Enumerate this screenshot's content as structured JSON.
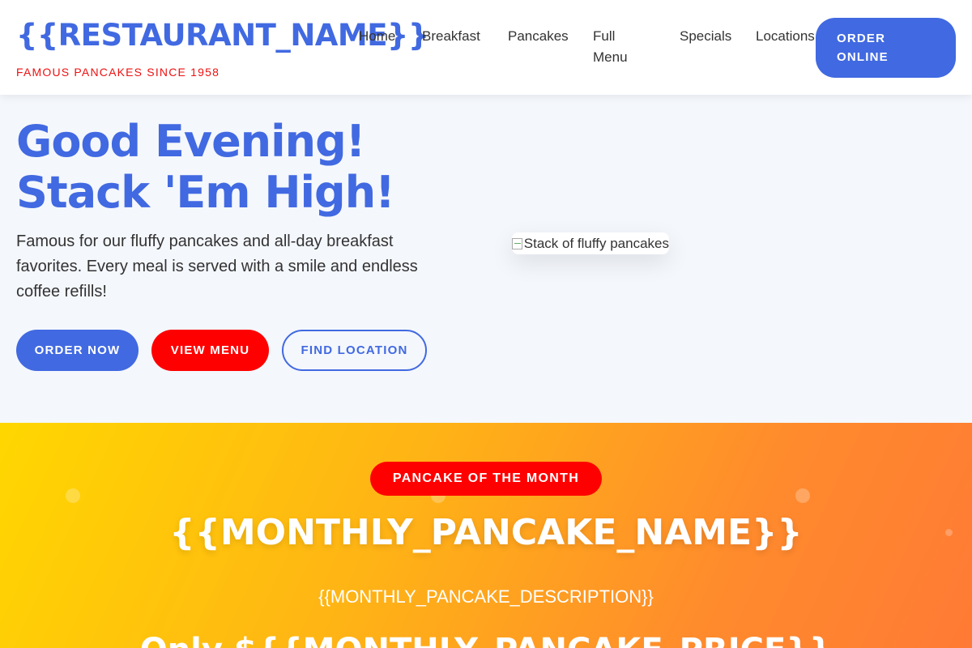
{
  "header": {
    "brand_name": "{{RESTAURANT_NAME}}",
    "brand_tagline": "FAMOUS PANCAKES SINCE 1958",
    "nav": [
      "Home",
      "Breakfast",
      "Pancakes",
      "Full Menu",
      "Specials",
      "Locations"
    ],
    "order_online_label": "ORDER ONLINE"
  },
  "hero": {
    "title": "Good Evening! Stack 'Em High!",
    "description": "Famous for our fluffy pancakes and all-day breakfast favorites. Every meal is served with a smile and endless coffee refills!",
    "buttons": [
      "ORDER NOW",
      "VIEW MENU",
      "FIND LOCATION"
    ],
    "image_alt": "Stack of fluffy pancakes"
  },
  "promo": {
    "badge": "PANCAKE OF THE MONTH",
    "name": "{{MONTHLY_PANCAKE_NAME}}",
    "description": "{{MONTHLY_PANCAKE_DESCRIPTION}}",
    "price_line": "Only ${{MONTHLY_PANCAKE_PRICE}}"
  },
  "colors": {
    "brand_blue": "#4169e1",
    "accent_red": "#ff0000",
    "promo_gradient_start": "#ffd700",
    "promo_gradient_end": "#ff7a35"
  }
}
